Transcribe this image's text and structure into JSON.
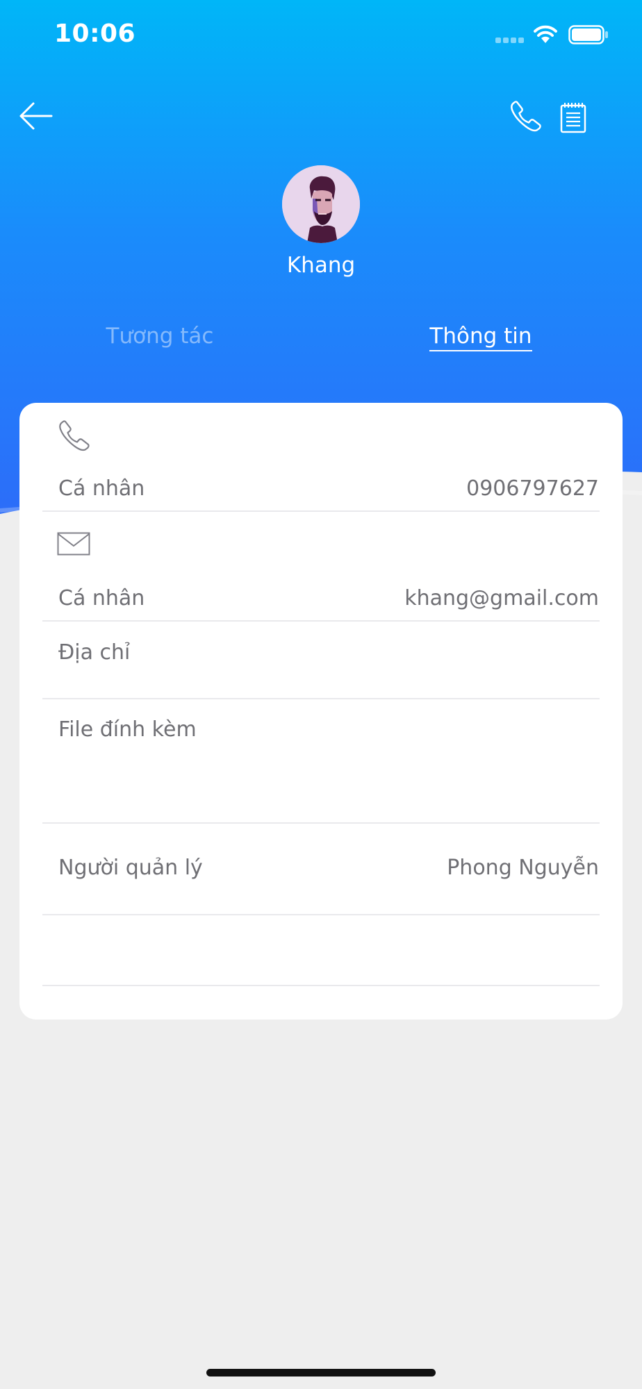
{
  "status_bar": {
    "time": "10:06"
  },
  "contact": {
    "name": "Khang"
  },
  "tabs": [
    {
      "label": "Tương tác",
      "active": false
    },
    {
      "label": "Thông tin",
      "active": true
    }
  ],
  "info": {
    "phone": {
      "type_label": "Cá nhân",
      "value": "0906797627"
    },
    "email": {
      "type_label": "Cá nhân",
      "value": "khang@gmail.com"
    },
    "address_label": "Địa chỉ",
    "attachments_label": "File đính kèm",
    "manager": {
      "label": "Người quản lý",
      "value": "Phong Nguyễn"
    }
  },
  "icons": {
    "back": "arrow-left-icon",
    "call": "phone-icon",
    "notes": "notepad-icon",
    "phone_row": "phone-icon",
    "email_row": "envelope-icon"
  },
  "colors": {
    "header_gradient_top": "#00b6f8",
    "header_gradient_bottom": "#2c6df9",
    "card_text": "#6f6f74",
    "background": "#eeeeee"
  }
}
